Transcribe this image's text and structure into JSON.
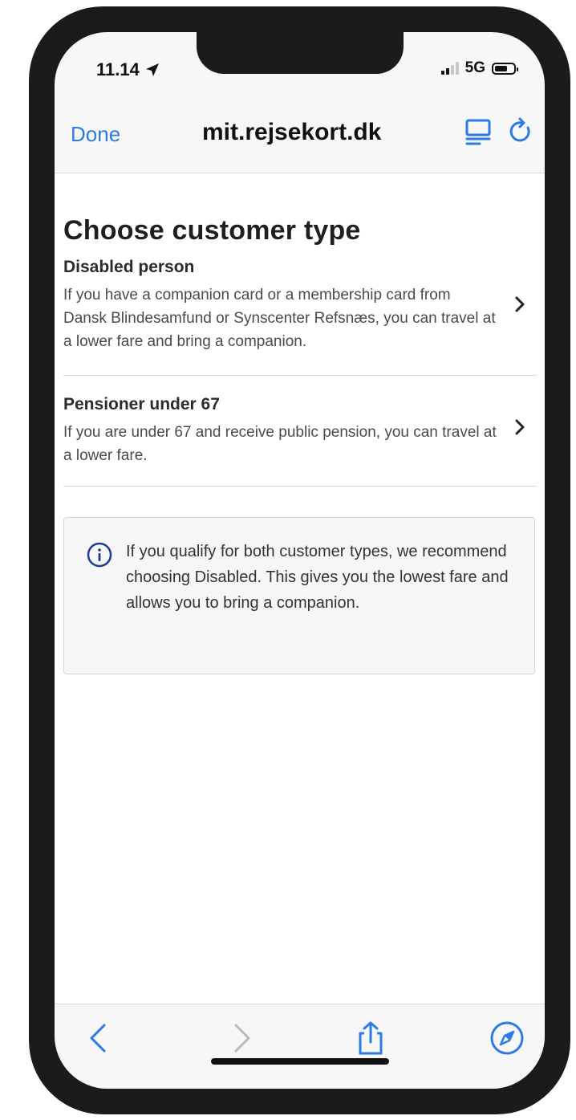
{
  "status": {
    "time": "11.14",
    "network": "5G"
  },
  "navbar": {
    "done_label": "Done",
    "url": "mit.rejsekort.dk"
  },
  "page": {
    "title": "Choose customer type",
    "options": [
      {
        "title": "Disabled person",
        "description": "If you have a companion card or a membership card from Dansk Blindesamfund or Synscenter Refsnæs, you can travel at a lower fare and bring a companion."
      },
      {
        "title": "Pensioner under 67",
        "description": "If you are under 67 and receive public pension, you can travel at a lower fare."
      }
    ],
    "info": "If you qualify for both customer types, we recommend choosing Disabled. This gives you the lowest fare and allows you to bring a companion."
  },
  "colors": {
    "accent": "#2c7be5",
    "info_icon": "#1f3a93",
    "frame": "#1b1b1d"
  },
  "icons": {
    "reader": "reader-icon",
    "reload": "reload-icon",
    "back": "back-arrow-icon",
    "forward": "forward-arrow-icon",
    "share": "share-icon",
    "safari": "compass-icon",
    "location": "location-arrow-icon",
    "info": "info-icon",
    "chevron": "chevron-right-icon"
  }
}
